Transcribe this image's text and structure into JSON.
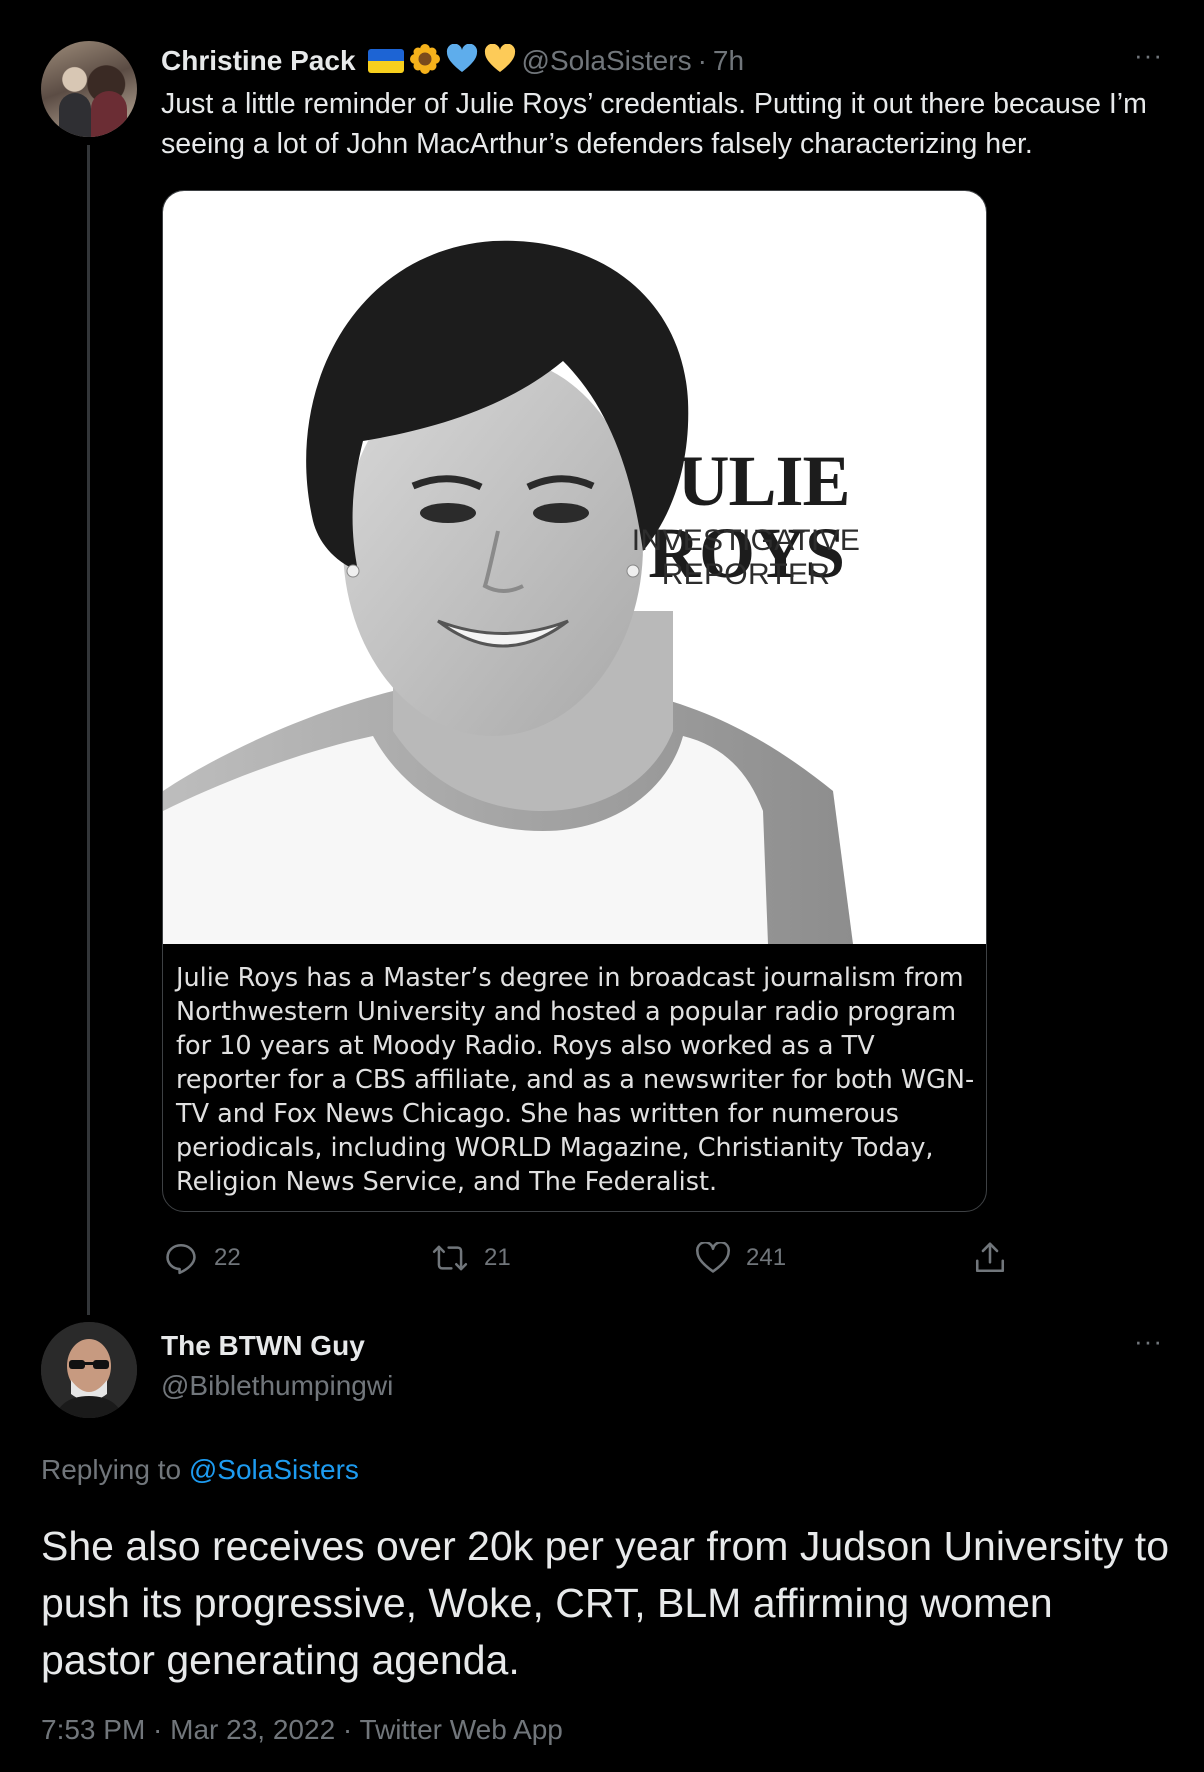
{
  "tweet": {
    "display_name": "Christine Pack",
    "name_emojis": [
      "ukraine-flag",
      "sunflower",
      "blue-heart",
      "yellow-heart"
    ],
    "handle": "@SolaSisters",
    "separator": "·",
    "time_ago": "7h",
    "more_label": "···",
    "text": "Just a little reminder of Julie Roys’ credentials. Putting it out there because I’m seeing a lot of John MacArthur’s defenders falsely characterizing her.",
    "media": {
      "name": "JULIE ROYS",
      "role": "INVESTIGATIVE REPORTER",
      "caption": "Julie Roys has a Master’s degree in broadcast journalism from Northwestern University and hosted a popular radio program for 10 years at Moody Radio. Roys also worked as a TV reporter for a CBS affiliate, and as a newswriter for both WGN-TV and Fox News Chicago. She has written for numerous periodicals, including WORLD Magazine, Christianity Today, Religion News Service, and The Federalist."
    },
    "actions": {
      "replies": "22",
      "retweets": "21",
      "likes": "241"
    }
  },
  "reply": {
    "display_name": "The BTWN Guy",
    "handle": "@Biblethumpingwi",
    "more_label": "···",
    "replying_prefix": "Replying to",
    "replying_to": "@SolaSisters",
    "text": "She also receives over 20k per year from Judson University to push its progressive, Woke, CRT, BLM affirming women pastor generating agenda.",
    "meta": "7:53 PM · Mar 23, 2022 · Twitter Web App"
  },
  "colors": {
    "background": "#000000",
    "primary_text": "#e7e9ea",
    "secondary_text": "#71767b",
    "link": "#1d9bf0",
    "border": "#3e4144"
  }
}
